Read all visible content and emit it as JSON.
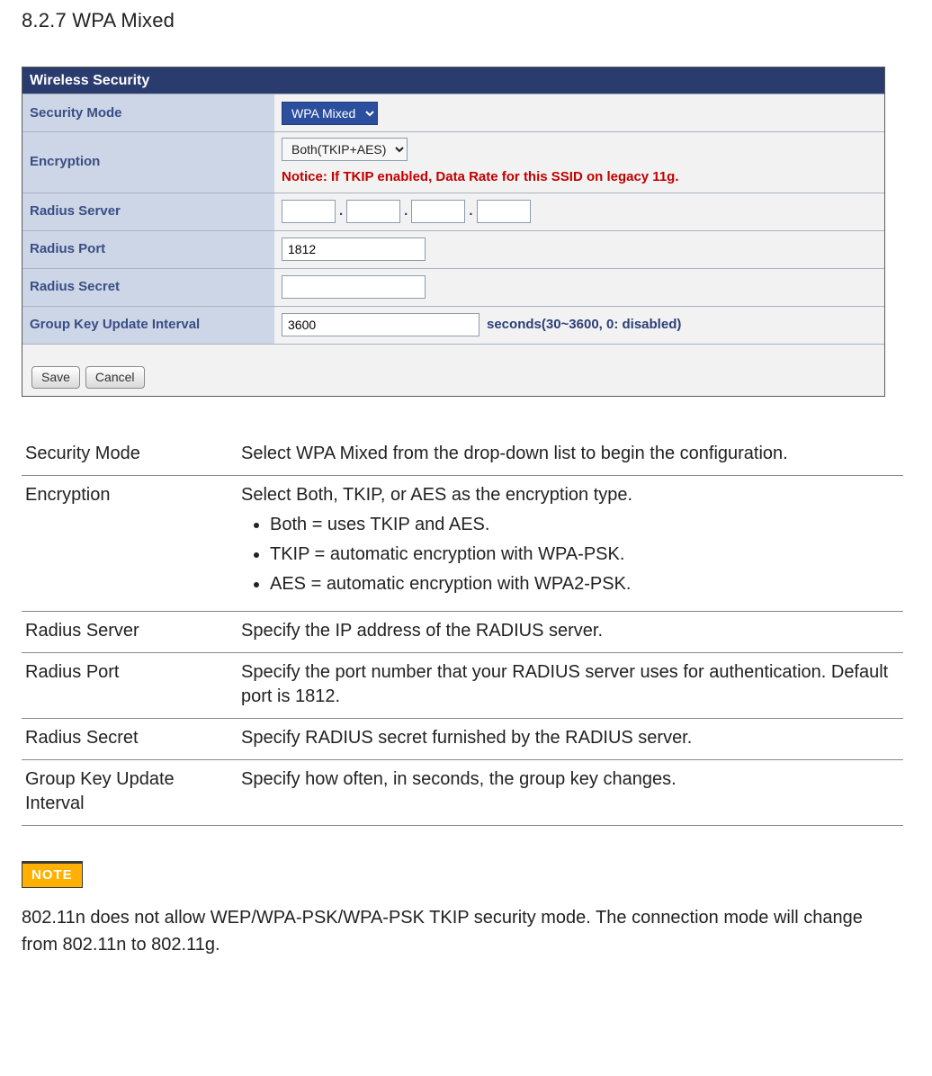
{
  "section_title": "8.2.7 WPA Mixed",
  "panel": {
    "title": "Wireless Security",
    "rows": {
      "security_mode": {
        "label": "Security Mode",
        "value": "WPA Mixed"
      },
      "encryption": {
        "label": "Encryption",
        "value": "Both(TKIP+AES)",
        "notice": "Notice: If TKIP enabled, Data Rate for this SSID on legacy 11g."
      },
      "radius_server": {
        "label": "Radius Server",
        "octets": [
          "",
          "",
          "",
          ""
        ]
      },
      "radius_port": {
        "label": "Radius Port",
        "value": "1812"
      },
      "radius_secret": {
        "label": "Radius Secret",
        "value": ""
      },
      "gkui": {
        "label": "Group Key Update Interval",
        "value": "3600",
        "hint": "seconds(30~3600, 0: disabled)"
      }
    },
    "buttons": {
      "save": "Save",
      "cancel": "Cancel"
    }
  },
  "descriptions": [
    {
      "term": "Security Mode",
      "text": "Select WPA Mixed from the drop-down list to begin the configuration."
    },
    {
      "term": "Encryption",
      "text": "Select Both, TKIP, or AES as the encryption type.",
      "bullets": [
        "Both = uses TKIP and AES.",
        "TKIP = automatic encryption with WPA-PSK.",
        "AES = automatic encryption with WPA2-PSK."
      ]
    },
    {
      "term": "Radius Server",
      "text": "Specify the IP address of the RADIUS server."
    },
    {
      "term": "Radius Port",
      "text": "Specify the port number that your RADIUS server uses for authentication. Default port is 1812."
    },
    {
      "term": "Radius Secret",
      "text": "Specify RADIUS secret furnished by the RADIUS server."
    },
    {
      "term": "Group Key Update Interval",
      "text": "Specify how often, in seconds, the group key changes."
    }
  ],
  "note": {
    "badge": "NOTE",
    "text": "802.11n does not allow WEP/WPA-PSK/WPA-PSK TKIP security mode. The connection mode will change from 802.11n to 802.11g."
  }
}
